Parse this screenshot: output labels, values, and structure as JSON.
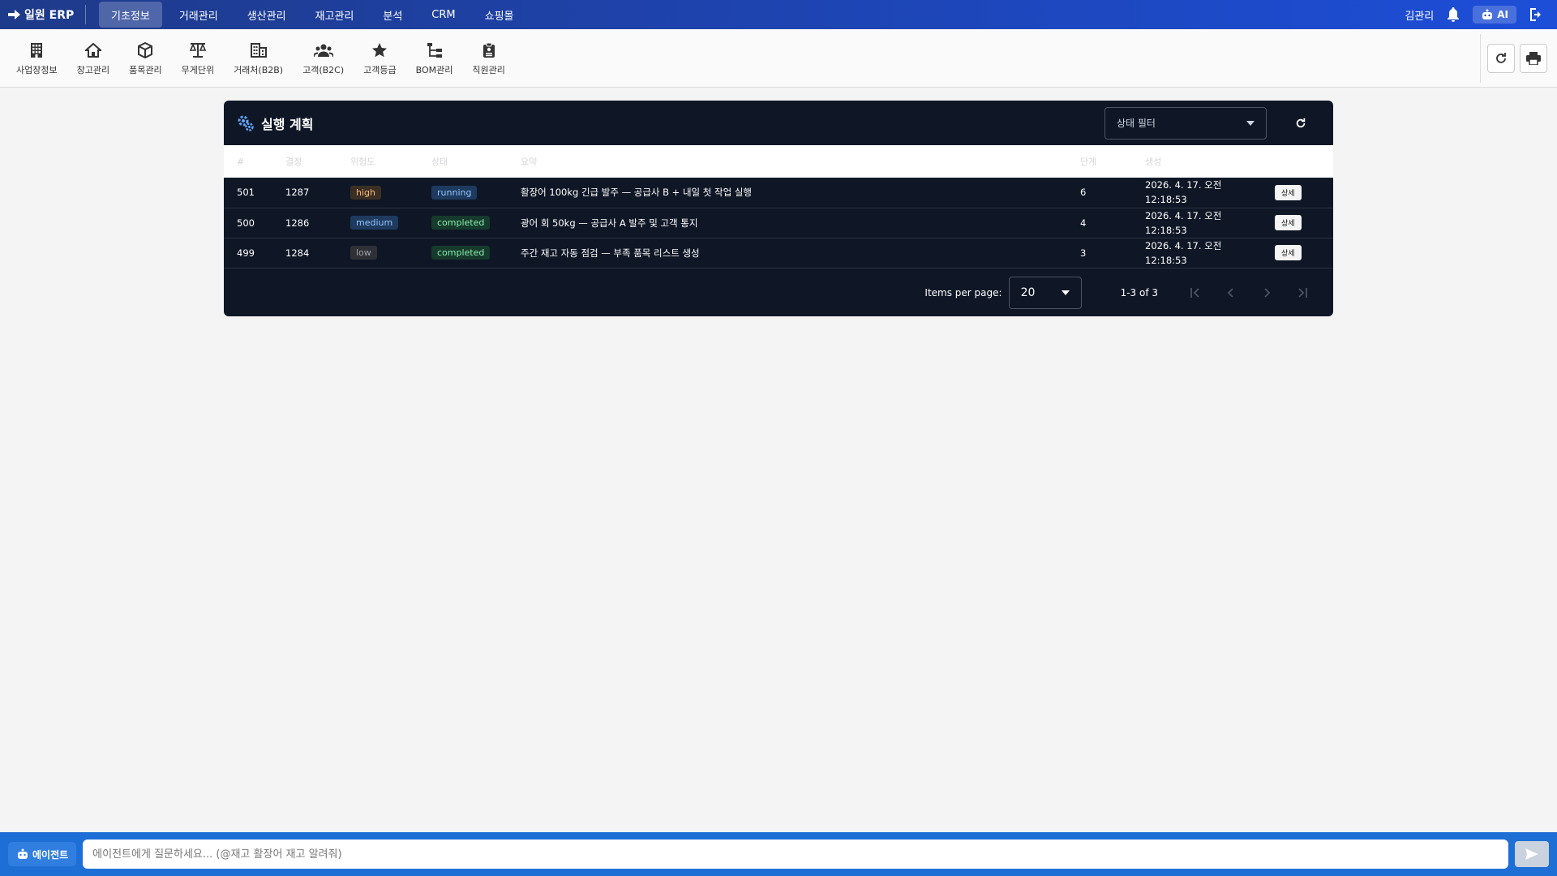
{
  "app": {
    "brand": "일원 ERP"
  },
  "topnav": [
    {
      "label": "기초정보",
      "active": true
    },
    {
      "label": "거래관리"
    },
    {
      "label": "생산관리"
    },
    {
      "label": "재고관리"
    },
    {
      "label": "분석"
    },
    {
      "label": "CRM"
    },
    {
      "label": "쇼핑몰"
    }
  ],
  "user": {
    "name": "김관리",
    "ai_label": "AI"
  },
  "toolbar": [
    {
      "label": "사업장정보",
      "icon": "building-icon"
    },
    {
      "label": "창고관리",
      "icon": "home-icon"
    },
    {
      "label": "품목관리",
      "icon": "box-icon"
    },
    {
      "label": "무게단위",
      "icon": "scale-icon"
    },
    {
      "label": "거래처(B2B)",
      "icon": "company-icon"
    },
    {
      "label": "고객(B2C)",
      "icon": "people-icon"
    },
    {
      "label": "고객등급",
      "icon": "star-icon"
    },
    {
      "label": "BOM관리",
      "icon": "tree-icon"
    },
    {
      "label": "직원관리",
      "icon": "badge-icon"
    }
  ],
  "panel": {
    "title": "실행 계획",
    "filter_placeholder": "상태 필터",
    "columns": [
      "#",
      "결정",
      "위험도",
      "상태",
      "요약",
      "단계",
      "생성",
      ""
    ],
    "rows": [
      {
        "id": "501",
        "decision": "1287",
        "risk": "high",
        "status": "running",
        "summary": "활장어 100kg 긴급 발주 — 공급사 B + 내일 첫 작업 실행",
        "steps": "6",
        "created_1": "2026. 4. 17. 오전",
        "created_2": "12:18:53",
        "action": "상세"
      },
      {
        "id": "500",
        "decision": "1286",
        "risk": "medium",
        "status": "completed",
        "summary": "광어 회 50kg — 공급사 A 발주 및 고객 통지",
        "steps": "4",
        "created_1": "2026. 4. 17. 오전",
        "created_2": "12:18:53",
        "action": "상세"
      },
      {
        "id": "499",
        "decision": "1284",
        "risk": "low",
        "status": "completed",
        "summary": "주간 재고 자동 점검 — 부족 품목 리스트 생성",
        "steps": "3",
        "created_1": "2026. 4. 17. 오전",
        "created_2": "12:18:53",
        "action": "상세"
      }
    ],
    "pager": {
      "items_per_page_label": "Items per page:",
      "items_per_page": "20",
      "range": "1-3 of 3"
    }
  },
  "agent": {
    "button_label": "에이전트",
    "placeholder": "에이전트에게 질문하세요... (@재고 활장어 재고 알려줘)"
  }
}
